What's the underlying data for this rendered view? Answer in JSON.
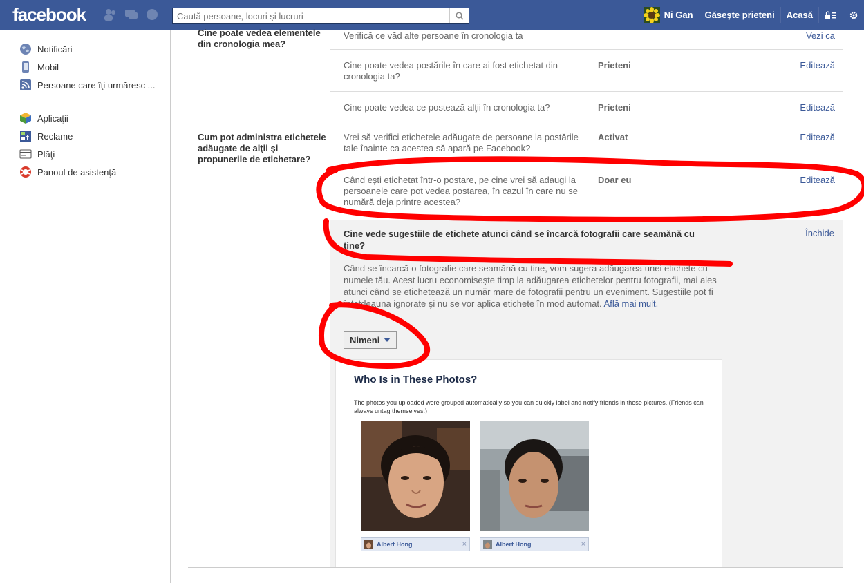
{
  "topbar": {
    "logo": "facebook",
    "search_placeholder": "Caută persoane, locuri şi lucruri",
    "user_name": "Ni Gan",
    "find_friends": "Găseşte prieteni",
    "home": "Acasă"
  },
  "sidebar": {
    "group1": [
      {
        "label": "Notificări",
        "icon": "globe-icon"
      },
      {
        "label": "Mobil",
        "icon": "mobile-icon"
      },
      {
        "label": "Persoane care îţi urmăresc ...",
        "icon": "rss-icon"
      }
    ],
    "group2": [
      {
        "label": "Aplicaţii",
        "icon": "apps-icon"
      },
      {
        "label": "Reclame",
        "icon": "ads-icon"
      },
      {
        "label": "Plăţi",
        "icon": "payments-icon"
      },
      {
        "label": "Panoul de asistenţă",
        "icon": "help-icon"
      }
    ]
  },
  "sections": {
    "timeline": {
      "label": "Cine poate vedea elementele din cronologia mea?",
      "rows": [
        {
          "desc": "Verifică ce văd alte persoane în cronologia ta",
          "value": "",
          "action": "Vezi ca"
        },
        {
          "desc": "Cine poate vedea postările în care ai fost etichetat din cronologia ta?",
          "value": "Prieteni",
          "action": "Editează"
        },
        {
          "desc": "Cine poate vedea ce postează alţii în cronologia ta?",
          "value": "Prieteni",
          "action": "Editează"
        }
      ]
    },
    "tags": {
      "label": "Cum pot administra etichetele adăugate de alţii şi propunerile de etichetare?",
      "rows": [
        {
          "desc": "Vrei să verifici etichetele adăugate de persoane la postările tale înainte ca acestea să apară pe Facebook?",
          "value": "Activat",
          "action": "Editează"
        },
        {
          "desc": "Când eşti etichetat într-o postare, pe cine vrei să adaugi la persoanele care pot vedea postarea, în cazul în care nu se numără deja printre acestea?",
          "value": "Doar eu",
          "action": "Editează"
        }
      ]
    }
  },
  "panel": {
    "title": "Cine vede sugestiile de etichete atunci când se încarcă fotografii care seamănă cu tine?",
    "close": "Închide",
    "desc": "Când se încarcă o fotografie care seamănă cu tine, vom sugera adăugarea unei etichete cu numele tău. Acest lucru economiseşte timp la adăugarea etichetelor pentru fotografii, mai ales atunci când se etichetează un număr mare de fotografii pentru un eveniment. Sugestiile pot fi întotdeauna ignorate şi nu se vor aplica etichete în mod automat.",
    "learn_more": "Află mai mult.",
    "select_value": "Nimeni",
    "preview": {
      "title": "Who Is in These Photos?",
      "text": "The photos you uploaded were grouped automatically so you can quickly label and notify friends in these pictures. (Friends can always untag themselves.)",
      "tags": [
        "Albert Hong",
        "Albert Hong"
      ],
      "remove": "×"
    }
  },
  "colors": {
    "brand": "#3b5998",
    "annotation": "#ff0000"
  }
}
